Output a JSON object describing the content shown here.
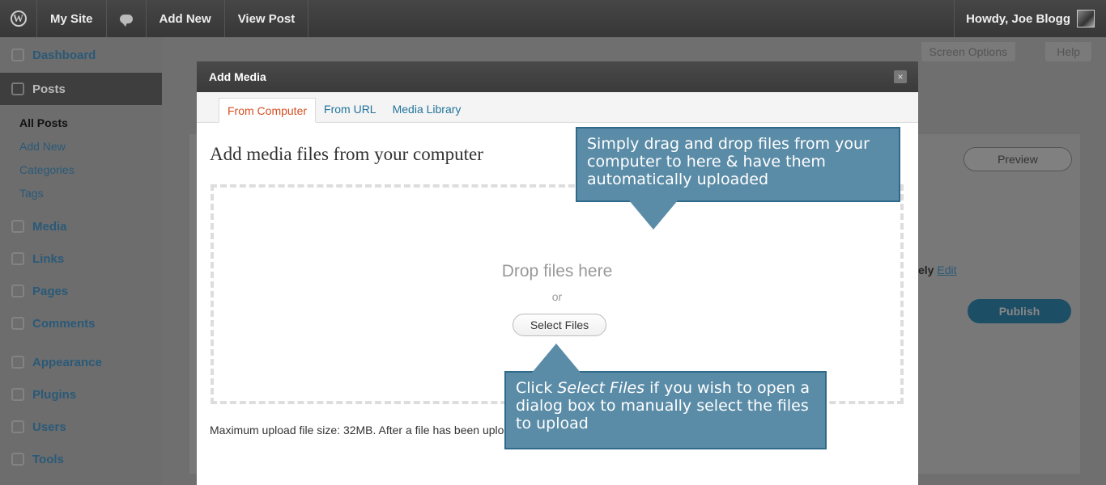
{
  "adminbar": {
    "site_name": "My Site",
    "add_new": "Add New",
    "view_post": "View Post",
    "howdy": "Howdy, Joe Blogg"
  },
  "sidebar": {
    "dashboard": "Dashboard",
    "posts": "Posts",
    "posts_submenu": [
      "All Posts",
      "Add New",
      "Categories",
      "Tags"
    ],
    "items": [
      "Media",
      "Links",
      "Pages",
      "Comments",
      "Appearance",
      "Plugins",
      "Users",
      "Tools"
    ]
  },
  "background": {
    "screen_options": "Screen Options",
    "help": "Help",
    "preview": "Preview",
    "publish": "Publish",
    "edit_fragment": "ely",
    "edit_link": "Edit"
  },
  "modal": {
    "title": "Add Media",
    "close": "×",
    "tabs": [
      "From Computer",
      "From URL",
      "Media Library"
    ],
    "heading": "Add media files from your computer",
    "drop_text": "Drop files here",
    "or_text": "or",
    "select_files": "Select Files",
    "max_upload": "Maximum upload file size: 32MB. After a file has been uploaded, you can add titles and descriptions."
  },
  "callouts": {
    "drag_drop": "Simply drag and drop files from your computer to here & have them automatically uploaded",
    "select_prefix": "Click ",
    "select_em": "Select Files",
    "select_suffix": " if you wish to open a dialog box to manually select the files to upload"
  }
}
